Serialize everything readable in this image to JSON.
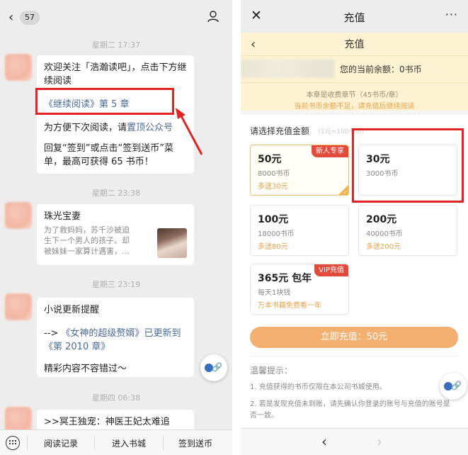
{
  "left": {
    "header": {
      "back_icon": "‹",
      "unread_count": "57",
      "profile_icon": "person-icon"
    },
    "messages": [
      {
        "time": "星期二 17:37",
        "para1": "欢迎关注「浩瀚读吧」，点击下方继续阅读",
        "link": "《继续阅读》第 5 章",
        "para3_prefix": "为方便下次阅读，请",
        "para3_link": "置顶公众号",
        "para4": "回复“签到”或点击“签到送币”菜单，最高可获得 65 书币！"
      },
      {
        "time": "星期二 23:38",
        "title": "珠光宝妻",
        "desc": "为了救妈妈，苏千沙被迫生下一个男人的孩子。却被妹妹一家算计遇害，…"
      },
      {
        "time": "星期三 23:19",
        "para1": "小说更新提醒",
        "arrow": "-->",
        "link1": "《女神的超级赘婿》",
        "mid": "已更新到",
        "link2": "《第 2010 章》",
        "para3": "精彩内容不容错过～"
      },
      {
        "time": "星期四 06:38",
        "para1": ">>冥王独宠：神医王妃太难追"
      }
    ],
    "bottom_menu": [
      "阅读记录",
      "进入书城",
      "签到送币"
    ]
  },
  "right": {
    "wx_title": "充值",
    "close_icon": "✕",
    "more_icon": "···",
    "page_title": "充值",
    "balance_label": "您的当前余额：0书币",
    "notice_chapter": "本章是收费章节（45书币/章）",
    "notice_insufficient": "当前书币余额不足，请充值后继续阅读",
    "choose_label": "请选择充值金额",
    "rate_label": "（1元=100书币）",
    "options": [
      {
        "price": "50元",
        "coins": "8000书币",
        "bonus": "多送30元",
        "tag": "新人专享",
        "selected": true
      },
      {
        "price": "30元",
        "coins": "3000书币",
        "bonus": "",
        "tag": "",
        "selected": false
      },
      {
        "price": "100元",
        "coins": "18000书币",
        "bonus": "多送80元",
        "tag": "",
        "selected": false
      },
      {
        "price": "200元",
        "coins": "40000书币",
        "bonus": "多送200元",
        "tag": "",
        "selected": false
      },
      {
        "price": "365元 包年",
        "coins": "每天1块钱",
        "bonus": "万本书籍免费看一年",
        "tag": "VIP充值",
        "selected": false
      }
    ],
    "pay_button": "立即充值：50元",
    "tips_title": "温馨提示：",
    "tips": [
      "1. 充值获得的书币仅限在本公司书城使用。",
      "2. 若是发现充值未到账，请先确认你登录的账号与充值的账号是否一致。"
    ],
    "nav_prev": "‹",
    "nav_next": "›"
  },
  "colors": {
    "highlight_red": "#e02424",
    "accent_orange": "#e8a14c",
    "pay_button": "#f3b070",
    "link_blue": "#4a6a9a"
  }
}
